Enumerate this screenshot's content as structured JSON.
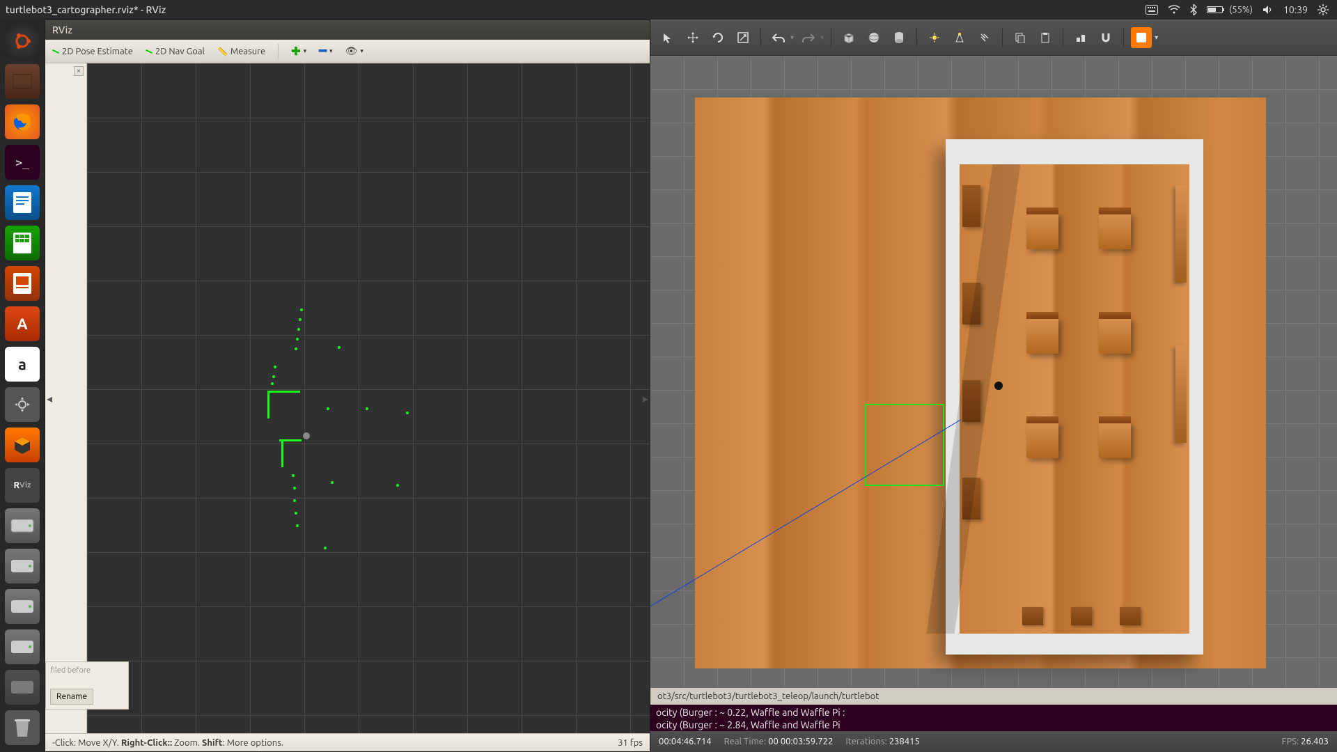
{
  "top_bar": {
    "title": "turtlebot3_cartographer.rviz* - RViz",
    "battery": "(55%)",
    "time": "10:39"
  },
  "launcher": {
    "items": [
      "ubuntu",
      "files",
      "firefox",
      "terminal",
      "writer",
      "calc",
      "impress",
      "store",
      "amazon",
      "settings",
      "gazebo",
      "rviz",
      "drive1",
      "drive2",
      "drive3",
      "drive4",
      "drive5"
    ]
  },
  "rviz": {
    "titlebar": "RViz",
    "tools": {
      "pose": "2D Pose Estimate",
      "nav": "2D Nav Goal",
      "measure": "Measure"
    },
    "bottom": {
      "text_upper": "filed before",
      "rename": "Rename"
    },
    "status": {
      "left_prefix": "-Click:",
      "move": "Move X/Y.",
      "right_prefix": "Right-Click::",
      "zoom": "Zoom.",
      "shift_key": "Shift",
      "shift_rest": ": More options.",
      "fps": "31 fps"
    }
  },
  "gazebo": {
    "terminal_path": "ot3/src/turtlebot3/turtlebot3_teleop/launch/turtlebot",
    "terminal_line1": "ocity (Burger : ~ 0.22, Waffle and Waffle Pi :",
    "terminal_line2": "ocity (Burger : ~ 2.84, Waffle and Waffle Pi",
    "status": {
      "sim_label": "",
      "sim_time": "00:04:46.714",
      "real_label": "Real Time:",
      "real_time": "00 00:03:59.722",
      "iter_label": "Iterations:",
      "iterations": "238415",
      "fps_label": "FPS:",
      "fps": "26.403"
    }
  }
}
